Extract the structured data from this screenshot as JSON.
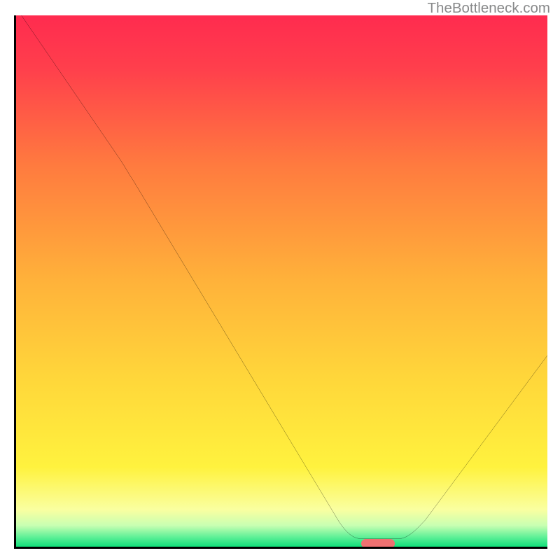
{
  "watermark": "TheBottleneck.com",
  "chart_data": {
    "type": "line",
    "title": "",
    "xlabel": "",
    "ylabel": "",
    "xlim": [
      0,
      100
    ],
    "ylim": [
      0,
      100
    ],
    "grid": false,
    "background_gradient": {
      "top_color": "#ff2b4f",
      "mid_color": "#ffd63a",
      "bottom_color": "#04d26b",
      "bottom_band_color": "#12e07a"
    },
    "curve_points": [
      {
        "x": 1.0,
        "y": 100.0
      },
      {
        "x": 19.5,
        "y": 73.0
      },
      {
        "x": 60.0,
        "y": 6.0
      },
      {
        "x": 65.0,
        "y": 1.5
      },
      {
        "x": 72.0,
        "y": 1.5
      },
      {
        "x": 77.0,
        "y": 5.0
      },
      {
        "x": 100.0,
        "y": 36.0
      }
    ],
    "optimum_marker": {
      "x": 68.0,
      "y": 1.3,
      "width_pct": 6.3
    },
    "annotations": []
  }
}
